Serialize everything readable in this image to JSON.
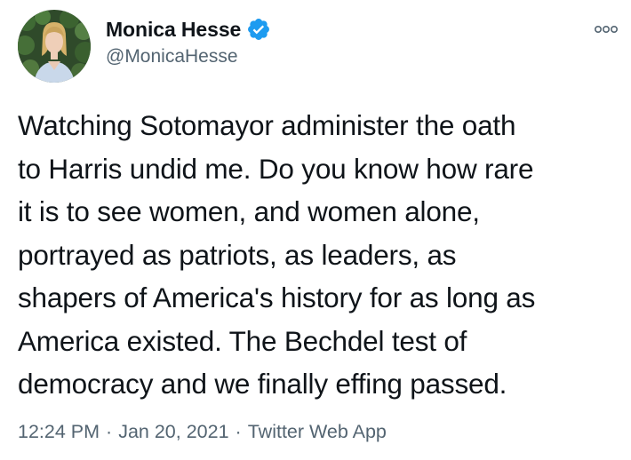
{
  "tweet": {
    "author": {
      "display_name": "Monica Hesse",
      "handle": "@MonicaHesse",
      "avatar_icon": "profile-photo",
      "verified_icon": "verified-badge-icon",
      "verified_color": "#1d9bf0"
    },
    "more_icon": "more-options-icon",
    "text": "Watching Sotomayor administer the oath\nto Harris undid me. Do you know how rare\nit is to see women, and women alone,\nportrayed as patriots, as leaders, as\nshapers of America's history for as long as\nAmerica existed. The Bechdel test of\ndemocracy and we finally effing passed.",
    "time": "12:24 PM",
    "separator": "·",
    "date": "Jan 20, 2021",
    "source": "Twitter Web App"
  }
}
